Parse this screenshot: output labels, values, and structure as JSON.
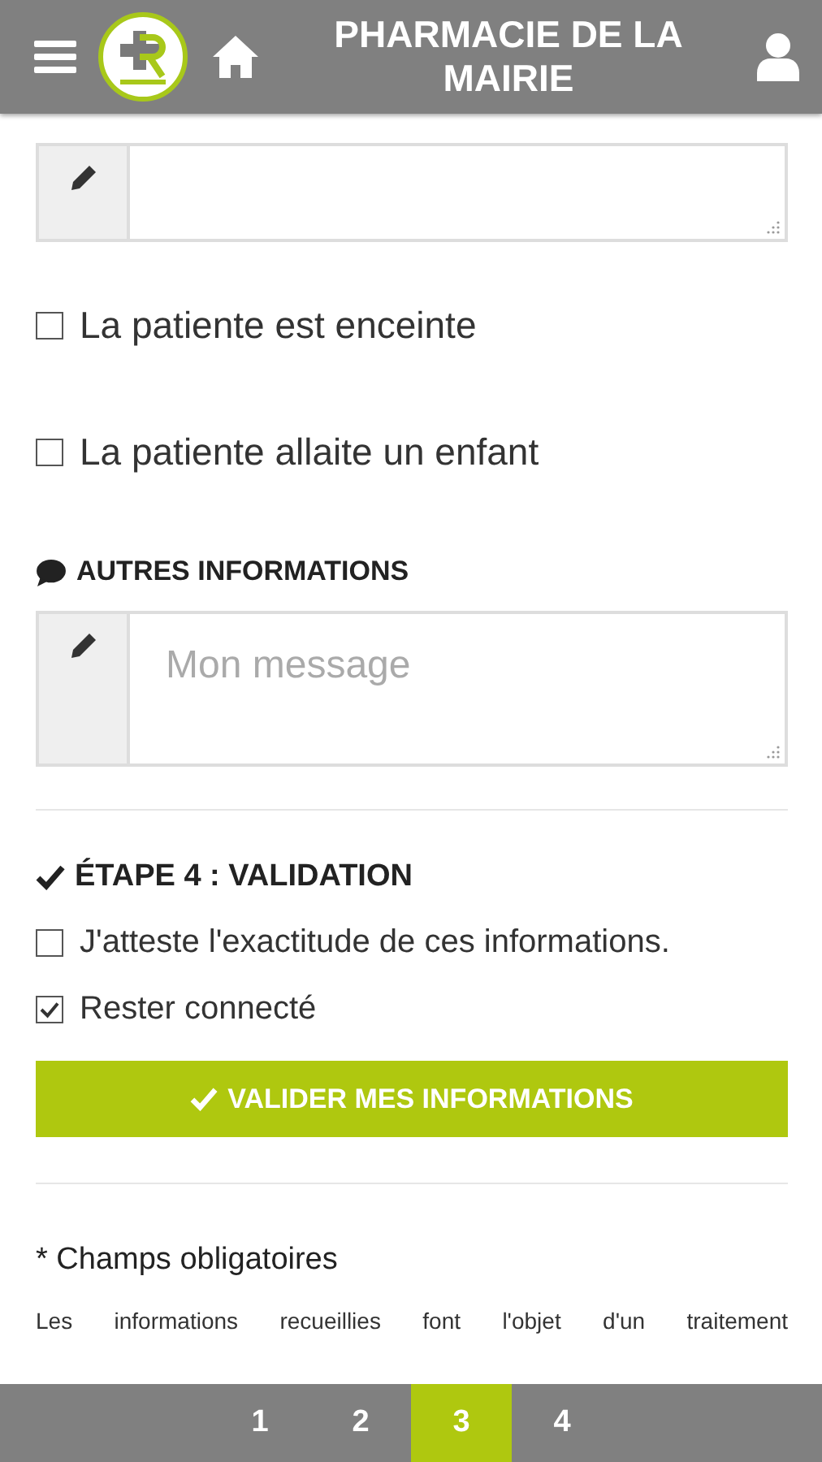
{
  "header": {
    "title": "PHARMACIE DE LA MAIRIE"
  },
  "pregnancy_options": [
    {
      "label": "La patiente est enceinte",
      "checked": false
    },
    {
      "label": "La patiente allaite un enfant",
      "checked": false
    }
  ],
  "other_info": {
    "heading": "AUTRES INFORMATIONS",
    "placeholder": "Mon message"
  },
  "validation": {
    "heading": "ÉTAPE 4 : VALIDATION",
    "options": [
      {
        "label": "J'atteste l'exactitude de ces informations.",
        "checked": false
      },
      {
        "label": "Rester connecté",
        "checked": true
      }
    ],
    "button": "VALIDER MES INFORMATIONS"
  },
  "required_note": "* Champs obligatoires",
  "legal_text": "Les informations recueillies font l'objet d'un traitement",
  "steps": [
    {
      "label": "1",
      "selected": false
    },
    {
      "label": "2",
      "selected": false
    },
    {
      "label": "3",
      "selected": true
    },
    {
      "label": "4",
      "selected": false
    }
  ]
}
